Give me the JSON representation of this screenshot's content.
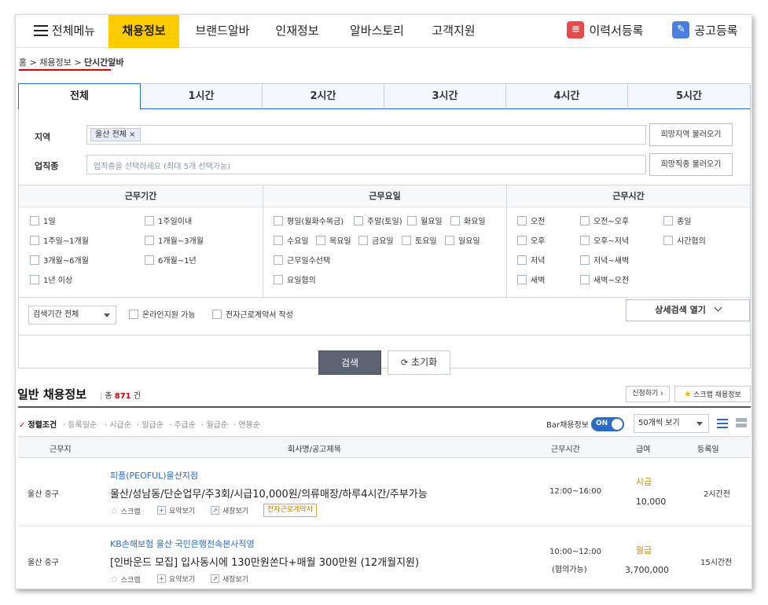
{
  "nav": {
    "menu_label": "전체메뉴",
    "items": [
      "채용정보",
      "브랜드알바",
      "인재정보",
      "알바스토리",
      "고객지원"
    ],
    "resume_button": "이력서등록",
    "post_button": "공고등록",
    "accent": "#ffcc00"
  },
  "breadcrumb": {
    "home": "홈",
    "sep": " > ",
    "mid": "채용정보",
    "current": "단시간알바"
  },
  "tabs": [
    "전체",
    "1시간",
    "2시간",
    "3시간",
    "4시간",
    "5시간"
  ],
  "filter": {
    "region_label": "지역",
    "region_chip": "울산 전체 ×",
    "region_button": "희망지역 불러오기",
    "job_label": "업직종",
    "job_placeholder": "업직종을 선택하세요 (최대 5개 선택가능)",
    "job_button": "희망직종 불러오기",
    "period": {
      "title": "근무기간",
      "options": [
        "1일",
        "1주일이내",
        "1주일~1개월",
        "1개월~3개월",
        "3개월~6개월",
        "6개월~1년",
        "1년 이상"
      ]
    },
    "days": {
      "title": "근무요일",
      "options": [
        "평일(월화수목금)",
        "주말(토일)",
        "월요일",
        "화요일",
        "수요일",
        "목요일",
        "금요일",
        "토요일",
        "일요일",
        "근무일수선택",
        "요일협의"
      ]
    },
    "time": {
      "title": "근무시간",
      "options": [
        "오전",
        "오전~오후",
        "종일",
        "오후",
        "오후~저녁",
        "시간협의",
        "저녁",
        "저녁~새벽",
        "새벽",
        "새벽~오전"
      ]
    },
    "search_period": "검색기간 전체",
    "online_apply": "온라인지원 가능",
    "e_contract": "전자근로계약서 작성",
    "detail_search": "상세검색 열기",
    "search_button": "검색",
    "reset_button": "초기화"
  },
  "results": {
    "title": "일반 채용정보",
    "count_prefix": "총",
    "count": "871",
    "count_suffix": "건",
    "apply_button": "신청하기 ›",
    "scrap_button": "스크랩 채용정보",
    "sort_label": "정렬조건",
    "sort_options": [
      "등록일순",
      "시급순",
      "일급순",
      "주급순",
      "월급순",
      "연봉순"
    ],
    "bar_label": "Bar채용정보",
    "toggle_text": "ON",
    "per_page": "50개씩 보기",
    "headers": [
      "근무지",
      "회사명/공고제목",
      "근무시간",
      "급여",
      "등록일"
    ],
    "rows": [
      {
        "location": "울산 중구",
        "company": "피플(PEOFUL)울산지점",
        "title": "울산/성남동/단순업무/주3회/시급10,000원/의류매장/하루4시간/주부가능",
        "time": "12:00~16:00",
        "time_note": "",
        "pay_type": "시급",
        "pay": "10,000",
        "posted": "2시간전",
        "badge": "전자근로계약서"
      },
      {
        "location": "울산 중구",
        "company": "KB손해보험 울산 국민은행전속본사직영",
        "title": "[인바운드 모집] 입사동시에 130만원쏜다+매월 300만원 (12개월지원)",
        "time": "10:00~12:00",
        "time_note": "(협의가능)",
        "pay_type": "월급",
        "pay": "3,700,000",
        "posted": "15시간전",
        "badge": ""
      }
    ],
    "actions": {
      "scrap": "스크랩",
      "summary": "요약보기",
      "new_window": "새창보기"
    }
  }
}
